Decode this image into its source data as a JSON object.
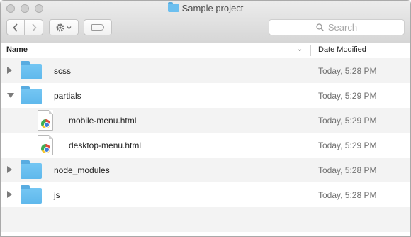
{
  "window": {
    "title": "Sample project"
  },
  "toolbar": {
    "back_icon": "chevron-left-icon",
    "forward_icon": "chevron-right-icon",
    "action_icon": "gear-icon",
    "tag_icon": "tag-icon"
  },
  "search": {
    "placeholder": "Search"
  },
  "columns": {
    "name": "Name",
    "date_modified": "Date Modified"
  },
  "items": [
    {
      "name": "scss",
      "kind": "folder",
      "expanded": false,
      "date": "Today, 5:28 PM"
    },
    {
      "name": "partials",
      "kind": "folder",
      "expanded": true,
      "date": "Today, 5:29 PM"
    },
    {
      "name": "mobile-menu.html",
      "kind": "html-file",
      "date": "Today, 5:29 PM"
    },
    {
      "name": "desktop-menu.html",
      "kind": "html-file",
      "date": "Today, 5:29 PM"
    },
    {
      "name": "node_modules",
      "kind": "folder",
      "expanded": false,
      "date": "Today, 5:28 PM"
    },
    {
      "name": "js",
      "kind": "folder",
      "expanded": false,
      "date": "Today, 5:28 PM"
    }
  ],
  "colors": {
    "folder": "#6cbfef",
    "row_alt": "#f3f3f3"
  }
}
